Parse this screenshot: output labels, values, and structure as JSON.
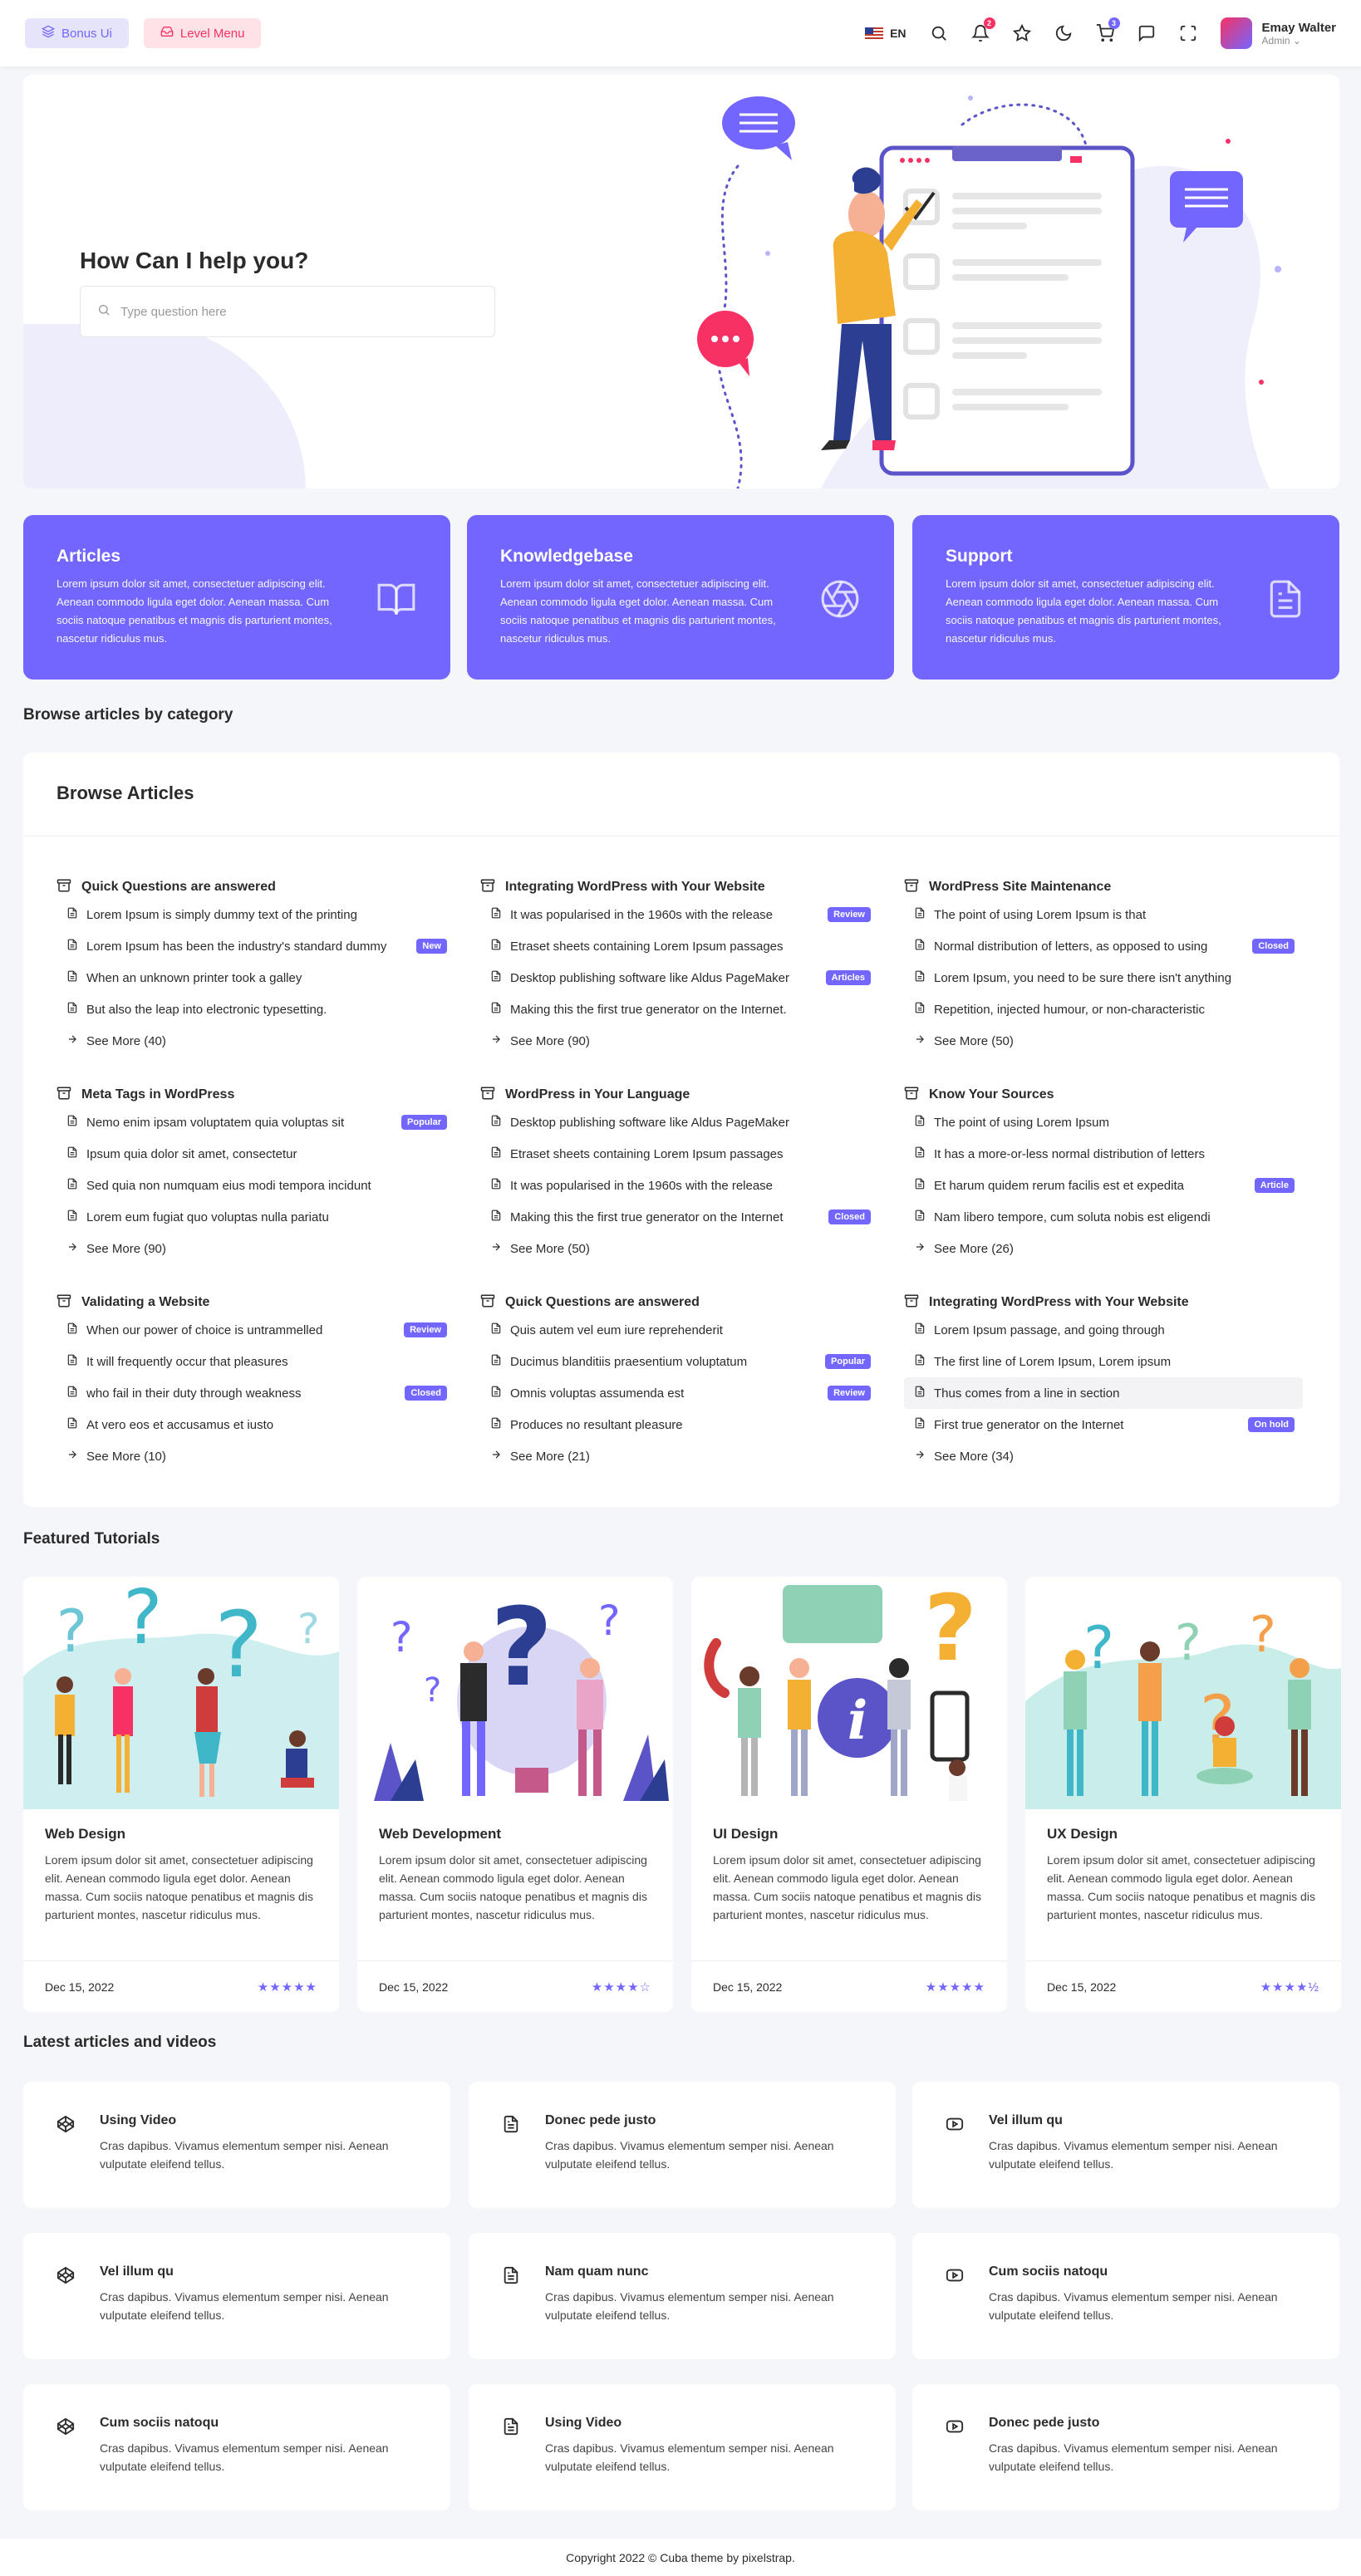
{
  "header": {
    "bonus_label": "Bonus Ui",
    "level_label": "Level Menu",
    "lang": "EN",
    "notif_count": "2",
    "cart_count": "3",
    "user_name": "Emay Walter",
    "user_role": "Admin"
  },
  "hero": {
    "title": "How Can I help you?",
    "search_placeholder": "Type question here"
  },
  "features": [
    {
      "title": "Articles",
      "desc": "Lorem ipsum dolor sit amet, consectetuer adipiscing elit. Aenean commodo ligula eget dolor. Aenean massa. Cum sociis natoque penatibus et magnis dis parturient montes, nascetur ridiculus mus.",
      "icon": "book-icon"
    },
    {
      "title": "Knowledgebase",
      "desc": "Lorem ipsum dolor sit amet, consectetuer adipiscing elit. Aenean commodo ligula eget dolor. Aenean massa. Cum sociis natoque penatibus et magnis dis parturient montes, nascetur ridiculus mus.",
      "icon": "aperture-icon"
    },
    {
      "title": "Support",
      "desc": "Lorem ipsum dolor sit amet, consectetuer adipiscing elit. Aenean commodo ligula eget dolor. Aenean massa. Cum sociis natoque penatibus et magnis dis parturient montes, nascetur ridiculus mus.",
      "icon": "file-text-icon"
    }
  ],
  "browse": {
    "section_title": "Browse articles by category",
    "card_title": "Browse Articles",
    "categories": [
      {
        "title": "Quick Questions are answered",
        "items": [
          {
            "text": "Lorem Ipsum is simply dummy text of the printing",
            "tag": ""
          },
          {
            "text": "Lorem Ipsum has been the industry's standard dummy",
            "tag": "New"
          },
          {
            "text": "When an unknown printer took a galley",
            "tag": ""
          },
          {
            "text": "But also the leap into electronic typesetting.",
            "tag": ""
          }
        ],
        "see_more": "See More (40)"
      },
      {
        "title": "Integrating WordPress with Your Website",
        "items": [
          {
            "text": "It was popularised in the 1960s with the release",
            "tag": "Review"
          },
          {
            "text": "Etraset sheets containing Lorem Ipsum passages",
            "tag": ""
          },
          {
            "text": "Desktop publishing software like Aldus PageMaker",
            "tag": "Articles"
          },
          {
            "text": "Making this the first true generator on the Internet.",
            "tag": ""
          }
        ],
        "see_more": "See More (90)"
      },
      {
        "title": "WordPress Site Maintenance",
        "items": [
          {
            "text": "The point of using Lorem Ipsum is that",
            "tag": ""
          },
          {
            "text": "Normal distribution of letters, as opposed to using",
            "tag": "Closed"
          },
          {
            "text": "Lorem Ipsum, you need to be sure there isn't anything",
            "tag": ""
          },
          {
            "text": "Repetition, injected humour, or non-characteristic",
            "tag": ""
          }
        ],
        "see_more": "See More (50)"
      },
      {
        "title": "Meta Tags in WordPress",
        "items": [
          {
            "text": "Nemo enim ipsam voluptatem quia voluptas sit",
            "tag": "Popular"
          },
          {
            "text": "Ipsum quia dolor sit amet, consectetur",
            "tag": ""
          },
          {
            "text": "Sed quia non numquam eius modi tempora incidunt",
            "tag": ""
          },
          {
            "text": "Lorem eum fugiat quo voluptas nulla pariatu",
            "tag": ""
          }
        ],
        "see_more": "See More (90)"
      },
      {
        "title": "WordPress in Your Language",
        "items": [
          {
            "text": "Desktop publishing software like Aldus PageMaker",
            "tag": ""
          },
          {
            "text": "Etraset sheets containing Lorem Ipsum passages",
            "tag": ""
          },
          {
            "text": "It was popularised in the 1960s with the release",
            "tag": ""
          },
          {
            "text": "Making this the first true generator on the Internet",
            "tag": "Closed"
          }
        ],
        "see_more": "See More (50)"
      },
      {
        "title": "Know Your Sources",
        "items": [
          {
            "text": "The point of using Lorem Ipsum",
            "tag": ""
          },
          {
            "text": "It has a more-or-less normal distribution of letters",
            "tag": ""
          },
          {
            "text": "Et harum quidem rerum facilis est et expedita",
            "tag": "Article"
          },
          {
            "text": "Nam libero tempore, cum soluta nobis est eligendi",
            "tag": ""
          }
        ],
        "see_more": "See More (26)"
      },
      {
        "title": "Validating a Website",
        "items": [
          {
            "text": "When our power of choice is untrammelled",
            "tag": "Review"
          },
          {
            "text": "It will frequently occur that pleasures",
            "tag": ""
          },
          {
            "text": "who fail in their duty through weakness",
            "tag": "Closed"
          },
          {
            "text": "At vero eos et accusamus et iusto",
            "tag": ""
          }
        ],
        "see_more": "See More (10)"
      },
      {
        "title": "Quick Questions are answered",
        "items": [
          {
            "text": "Quis autem vel eum iure reprehenderit",
            "tag": ""
          },
          {
            "text": "Ducimus blanditiis praesentium voluptatum",
            "tag": "Popular"
          },
          {
            "text": "Omnis voluptas assumenda est",
            "tag": "Review"
          },
          {
            "text": "Produces no resultant pleasure",
            "tag": ""
          }
        ],
        "see_more": "See More (21)"
      },
      {
        "title": "Integrating WordPress with Your Website",
        "items": [
          {
            "text": "Lorem Ipsum passage, and going through",
            "tag": ""
          },
          {
            "text": "The first line of Lorem Ipsum, Lorem ipsum",
            "tag": ""
          },
          {
            "text": "Thus comes from a line in section",
            "tag": ""
          },
          {
            "text": "First true generator on the Internet",
            "tag": "On hold"
          }
        ],
        "see_more": "See More (34)"
      }
    ]
  },
  "tutorials": {
    "section_title": "Featured Tutorials",
    "cards": [
      {
        "title": "Web Design",
        "desc": "Lorem ipsum dolor sit amet, consectetuer adipiscing elit. Aenean commodo ligula eget dolor. Aenean massa. Cum sociis natoque penatibus et magnis dis parturient montes, nascetur ridiculus mus.",
        "date": "Dec 15, 2022",
        "stars": "★★★★★",
        "rating": 5
      },
      {
        "title": "Web Development",
        "desc": "Lorem ipsum dolor sit amet, consectetuer adipiscing elit. Aenean commodo ligula eget dolor. Aenean massa. Cum sociis natoque penatibus et magnis dis parturient montes, nascetur ridiculus mus.",
        "date": "Dec 15, 2022",
        "stars": "★★★★☆",
        "rating": 4
      },
      {
        "title": "UI Design",
        "desc": "Lorem ipsum dolor sit amet, consectetuer adipiscing elit. Aenean commodo ligula eget dolor. Aenean massa. Cum sociis natoque penatibus et magnis dis parturient montes, nascetur ridiculus mus.",
        "date": "Dec 15, 2022",
        "stars": "★★★★★",
        "rating": 5
      },
      {
        "title": "UX Design",
        "desc": "Lorem ipsum dolor sit amet, consectetuer adipiscing elit. Aenean commodo ligula eget dolor. Aenean massa. Cum sociis natoque penatibus et magnis dis parturient montes, nascetur ridiculus mus.",
        "date": "Dec 15, 2022",
        "stars": "★★★★½",
        "rating": 4.5
      }
    ]
  },
  "latest": {
    "section_title": "Latest articles and videos",
    "items": [
      {
        "title": "Using Video",
        "desc": "Cras dapibus. Vivamus elementum semper nisi. Aenean vulputate eleifend tellus.",
        "icon": "codepen-icon"
      },
      {
        "title": "Donec pede justo",
        "desc": "Cras dapibus. Vivamus elementum semper nisi. Aenean vulputate eleifend tellus.",
        "icon": "file-text-icon"
      },
      {
        "title": "Vel illum qu",
        "desc": "Cras dapibus. Vivamus elementum semper nisi. Aenean vulputate eleifend tellus.",
        "icon": "youtube-icon"
      },
      {
        "title": "Vel illum qu",
        "desc": "Cras dapibus. Vivamus elementum semper nisi. Aenean vulputate eleifend tellus.",
        "icon": "codepen-icon"
      },
      {
        "title": "Nam quam nunc",
        "desc": "Cras dapibus. Vivamus elementum semper nisi. Aenean vulputate eleifend tellus.",
        "icon": "file-text-icon"
      },
      {
        "title": "Cum sociis natoqu",
        "desc": "Cras dapibus. Vivamus elementum semper nisi. Aenean vulputate eleifend tellus.",
        "icon": "youtube-icon"
      },
      {
        "title": "Cum sociis natoqu",
        "desc": "Cras dapibus. Vivamus elementum semper nisi. Aenean vulputate eleifend tellus.",
        "icon": "codepen-icon"
      },
      {
        "title": "Using Video",
        "desc": "Cras dapibus. Vivamus elementum semper nisi. Aenean vulputate eleifend tellus.",
        "icon": "file-text-icon"
      },
      {
        "title": "Donec pede justo",
        "desc": "Cras dapibus. Vivamus elementum semper nisi. Aenean vulputate eleifend tellus.",
        "icon": "youtube-icon"
      }
    ]
  },
  "footer": {
    "text": "Copyright 2022 © Cuba theme by pixelstrap."
  },
  "colors": {
    "primary": "#7366ff",
    "secondary": "#f73164"
  }
}
